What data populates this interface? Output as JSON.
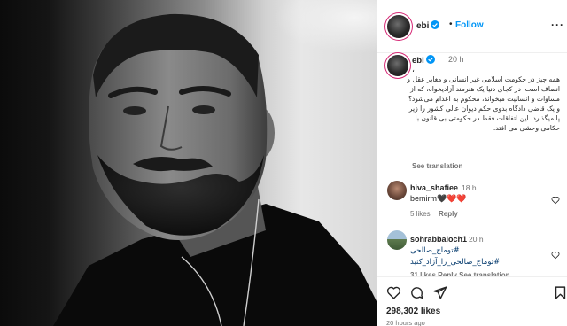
{
  "post": {
    "author": {
      "username": "ebi",
      "verified": true,
      "follow_label": "Follow",
      "more_icon": "more-icon"
    },
    "caption": {
      "username": "ebi",
      "time": "20 h",
      "mark": "،",
      "text": "همه چیز در حکومت اسلامی غیر انسانی و مغایر عقل و انصاف است. در کجای دنیا یک هنرمند آزادیخواه، که از مساوات و انسانیت میخواند، محکوم به اعدام می‌شود؟ و یک قاضی دادگاه بدوی حکم دیوان عالی کشور را زیر پا میگذارد. این اتفاقات فقط در حکومتی بی قانون با حکامی وحشی می افتد.",
      "see_translation": "See translation"
    },
    "comments": [
      {
        "username": "hiva_shafiee",
        "time": "18 h",
        "text": "bemirm🖤❤️❤️",
        "likes": "5 likes",
        "reply_label": "Reply"
      },
      {
        "username": "sohrabbaloch1",
        "time": "20 h",
        "tags": [
          "#توماج_صالحی",
          "#توماج_صالحی_را_آزاد_کنید"
        ],
        "meta": "31 likes   Reply   See translation"
      }
    ],
    "likes_count": "298,302 likes",
    "posted_ago": "20 hours ago"
  },
  "icons": {
    "like": "heart-icon",
    "comment": "comment-icon",
    "share": "share-icon",
    "save": "bookmark-icon",
    "verified": "verified-badge-icon"
  },
  "colors": {
    "accent": "#0095f6",
    "verified": "#0095f6",
    "text": "#262626",
    "muted": "#737373",
    "hashtag": "#00376b"
  }
}
